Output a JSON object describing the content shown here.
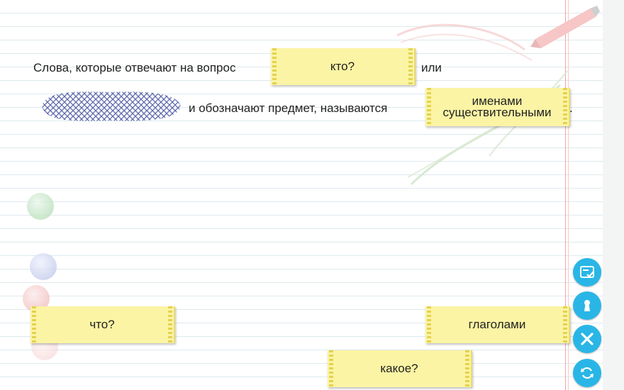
{
  "sentence": {
    "part1": "Слова, которые отвечают на вопрос",
    "part2": "или",
    "part3": "и обозначают предмет, называются",
    "period": "."
  },
  "placed_cards": {
    "question_card": "кто?",
    "answer_card_line1": "именами",
    "answer_card_line2": "существительными"
  },
  "answer_options": [
    {
      "label": "что?"
    },
    {
      "label": "глаголами"
    },
    {
      "label": "какое?"
    }
  ],
  "tools": [
    {
      "icon": "check-list-icon"
    },
    {
      "icon": "keyhole-icon"
    },
    {
      "icon": "close-icon"
    },
    {
      "icon": "refresh-icon"
    }
  ],
  "colors": {
    "card": "#fbf4a4",
    "tool_button": "#29b6e6",
    "margin_line": "#f2a3a3"
  }
}
